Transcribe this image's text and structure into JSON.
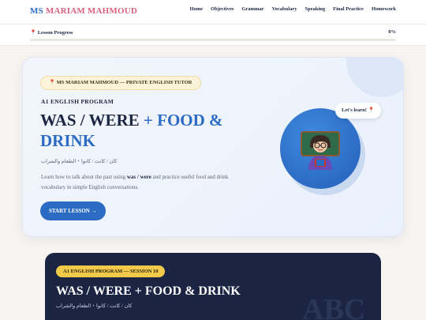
{
  "header": {
    "brand_ms": "MS",
    "brand_name": "MARIAM MAHMOUD",
    "nav": [
      "Home",
      "Objectives",
      "Grammar",
      "Vocabulary",
      "Speaking",
      "Final Practice",
      "Homework"
    ]
  },
  "progress": {
    "label": "📍 Lesson Progress",
    "percent_text": "0%",
    "value": 0
  },
  "hero": {
    "tutor_badge": "📍 MS MARIAM MAHMOUD — PRIVATE ENGLISH TUTOR",
    "program": "A1 ENGLISH PROGRAM",
    "title_dark": "WAS / WERE",
    "title_blue": "+ FOOD & DRINK",
    "arabic": "كان / كانت / كانوا + الطعام والشراب",
    "desc_before": "Learn how to talk about the past using ",
    "desc_bold": "was / were",
    "desc_after": " and practice useful food and drink vocabulary in simple English conversations.",
    "cta": "START LESSON →",
    "bubble": "Let's learn! 📍",
    "avatar_icon": "teacher-avatar-icon"
  },
  "session": {
    "badge": "A1 ENGLISH PROGRAM — SESSION 10",
    "title": "WAS / WERE + FOOD & DRINK",
    "arabic": "كان / كانت / كانوا + الطعام والشراب",
    "decor": "ABC"
  },
  "colors": {
    "brand_blue": "#2c6bc4",
    "brand_pink": "#d9607d",
    "navy": "#1b2543",
    "gold": "#f3c94a"
  }
}
